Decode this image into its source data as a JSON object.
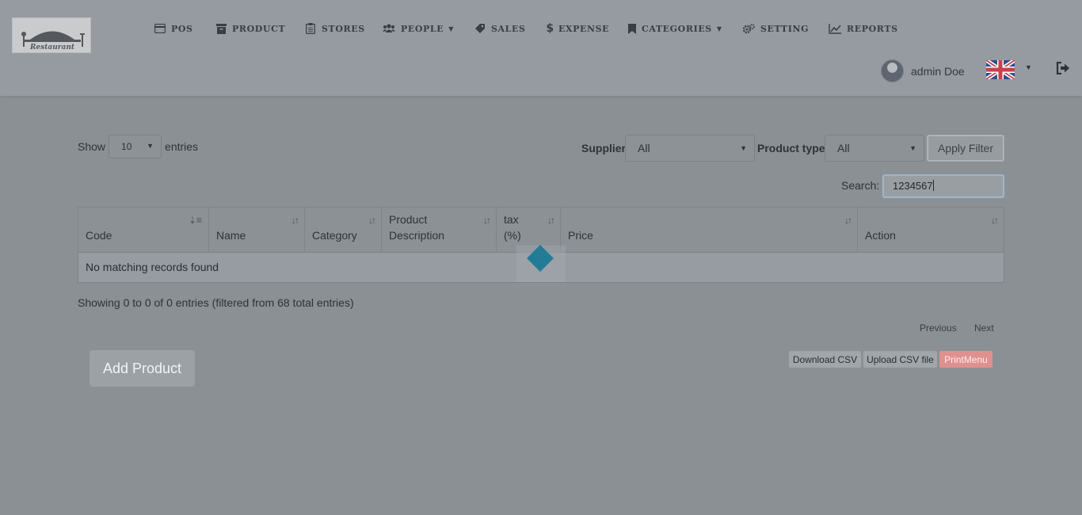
{
  "header": {
    "logo_text": "Restaurant",
    "nav": [
      {
        "label": "POS",
        "icon": "credit-card-icon"
      },
      {
        "label": "PRODUCT",
        "icon": "archive-icon"
      },
      {
        "label": "STORES",
        "icon": "clipboard-icon"
      },
      {
        "label": "PEOPLE",
        "icon": "users-icon",
        "dropdown": true
      },
      {
        "label": "SALES",
        "icon": "tag-icon"
      },
      {
        "label": "EXPENSE",
        "icon": "dollar-icon"
      },
      {
        "label": "CATEGORIES",
        "icon": "bookmark-icon",
        "dropdown": true
      },
      {
        "label": "SETTING",
        "icon": "gears-icon"
      },
      {
        "label": "REPORTS",
        "icon": "line-chart-icon"
      }
    ],
    "user_name": "admin Doe",
    "language_flag": "uk-flag-icon"
  },
  "controls": {
    "show_label": "Show",
    "entries_label": "entries",
    "page_length": "10",
    "supplier_label": "Supplier",
    "supplier_value": "All",
    "product_type_label": "Product type",
    "product_type_value": "All",
    "apply_filter": "Apply Filter",
    "search_label": "Search:",
    "search_value": "1234567"
  },
  "table": {
    "columns": [
      "Code",
      "Name",
      "Category",
      "Product\nDescription",
      "tax\n(%)",
      "Price",
      "Action"
    ],
    "empty_message": "No matching records found"
  },
  "footer": {
    "info": "Showing 0 to 0 of 0 entries (filtered from 68 total entries)",
    "previous": "Previous",
    "next": "Next",
    "add_product": "Add Product",
    "download_csv": "Download CSV",
    "upload_csv": "Upload CSV file",
    "print_menu": "PrintMenu"
  },
  "colors": {
    "loader": "#237c96",
    "print_button": "#e0908e"
  }
}
